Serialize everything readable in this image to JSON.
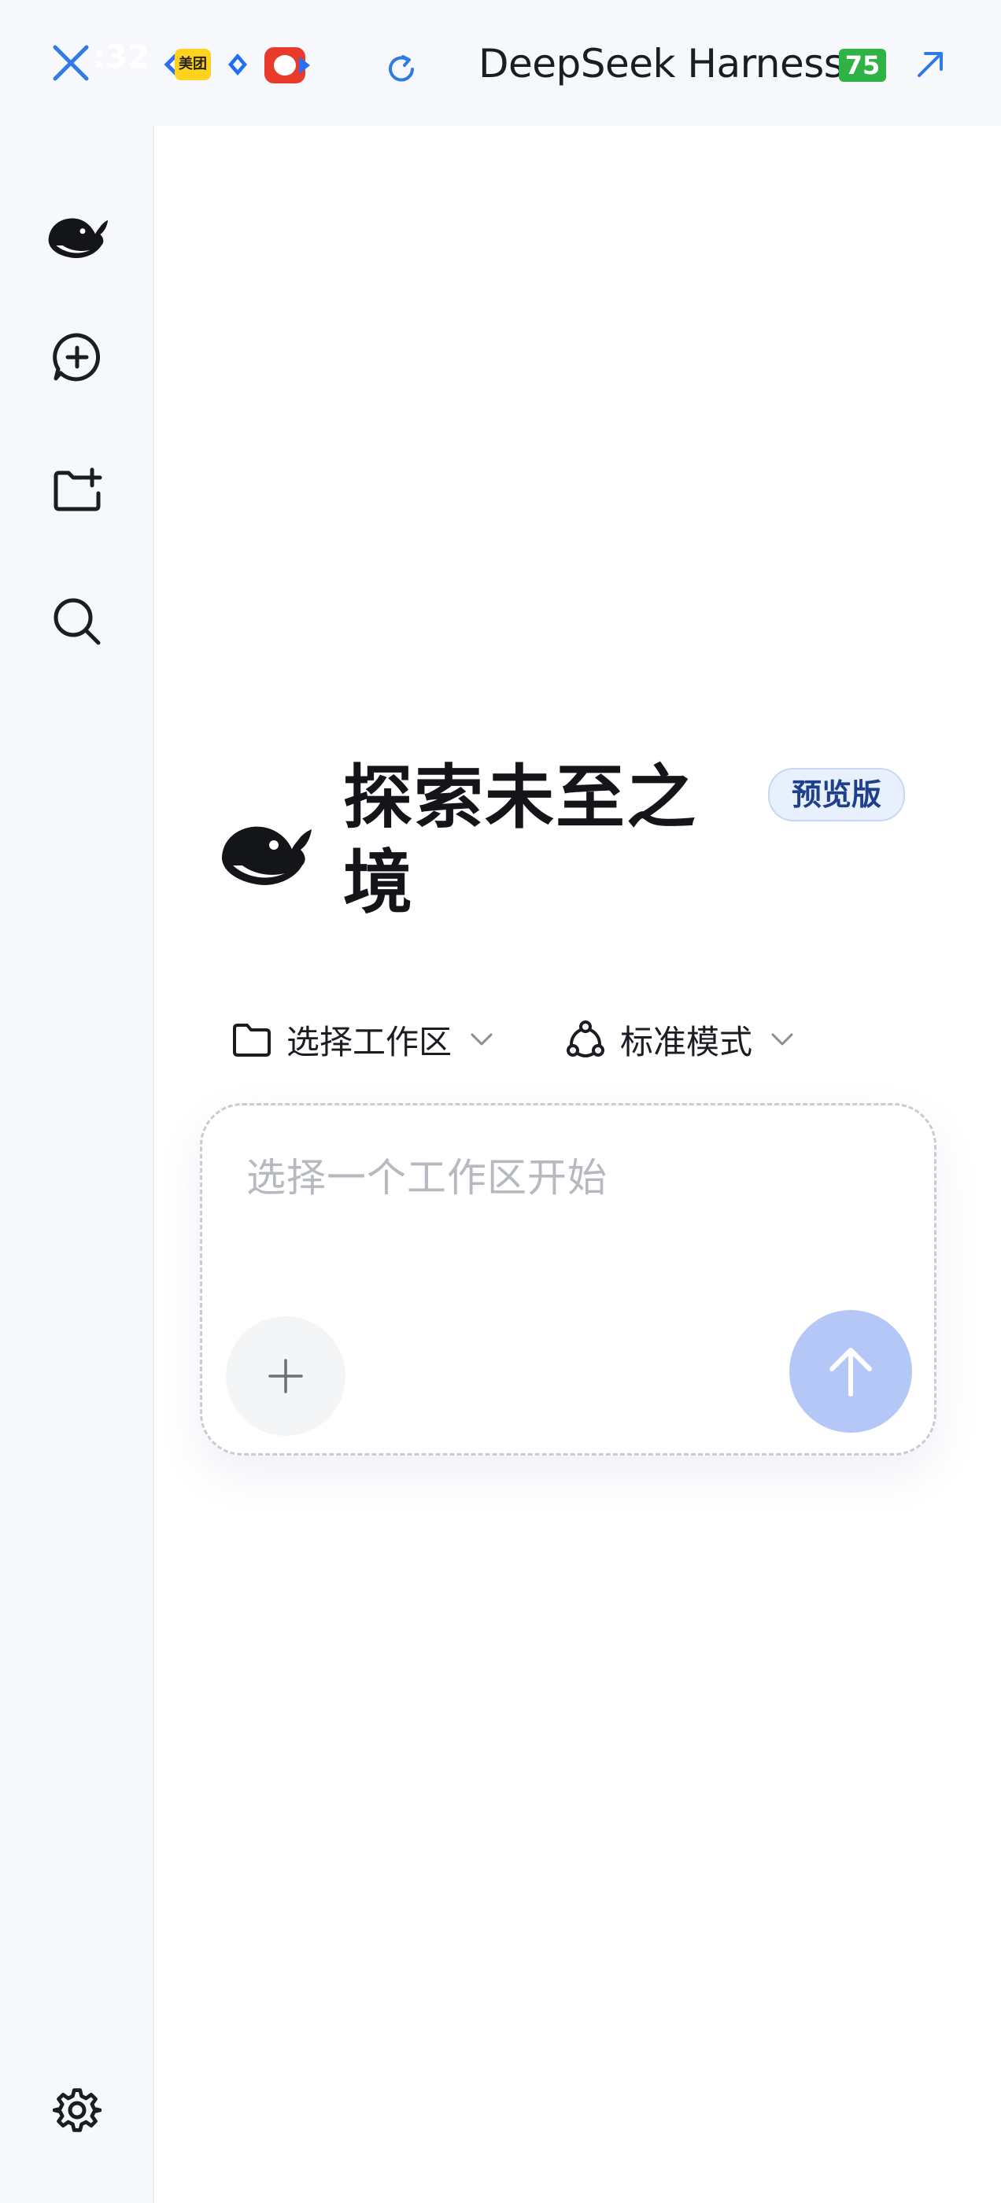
{
  "status_bar": {
    "clock": ":32",
    "meituan_label": "美团",
    "app_title": "DeepSeek Harness",
    "battery": "75"
  },
  "sidebar": {
    "items": [
      {
        "icon": "deepseek-logo-icon"
      },
      {
        "icon": "new-chat-icon"
      },
      {
        "icon": "new-workspace-icon"
      },
      {
        "icon": "search-icon"
      },
      {
        "icon": "settings-icon"
      }
    ]
  },
  "hero": {
    "title": "探索未至之境",
    "badge": "预览版"
  },
  "selectors": {
    "workspace_label": "选择工作区",
    "mode_label": "标准模式"
  },
  "composer": {
    "placeholder": "选择一个工作区开始"
  },
  "colors": {
    "accent": "#2f6ef0",
    "send_disabled": "#b4c7f6",
    "badge_bg": "#e8effd",
    "sidebar_bg": "#f6f8fb"
  }
}
